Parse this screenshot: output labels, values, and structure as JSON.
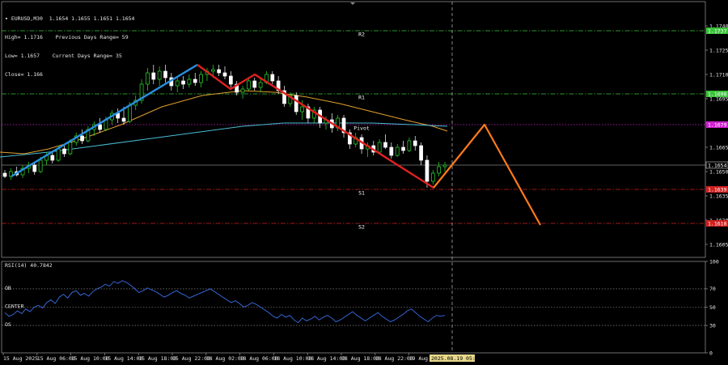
{
  "header": {
    "symbol_line": "EURUSD,M30  1.1654 1.1655 1.1651 1.1654",
    "stats": [
      {
        "left": "High= 1.1716",
        "right": "Previous Days Range= 59"
      },
      {
        "left": "Low= 1.1657",
        "right": "Current Days Range= 35"
      },
      {
        "left": "Close= 1.166",
        "right": ""
      }
    ]
  },
  "chart_data": {
    "type": "candlestick",
    "price_axis": {
      "range": [
        1.1597,
        1.1755
      ],
      "ticks": [
        1.174,
        1.1725,
        1.171,
        1.1695,
        1.168,
        1.1665,
        1.165,
        1.1635,
        1.162,
        1.1605
      ],
      "tick_labels": [
        "1.1740",
        "1.1725",
        "1.1710",
        "1.1695",
        "1.1680",
        "1.1665",
        "1.1650",
        "1.1635",
        "1.1620",
        "1.1605"
      ]
    },
    "levels": [
      {
        "name": "R2",
        "price": 1.1737,
        "tag": "1.1737",
        "color": "#39c439",
        "style": "dashdot",
        "tag_bg": "#39c439"
      },
      {
        "name": "R1",
        "price": 1.1698,
        "tag": "1.1698",
        "color": "#39c439",
        "style": "dashdot",
        "tag_bg": "#39c439"
      },
      {
        "name": "Pivot",
        "price": 1.1679,
        "tag": "1.1679",
        "color": "#d020d0",
        "style": "dotted",
        "tag_bg": "#d020d0"
      },
      {
        "name": "S1",
        "price": 1.1639,
        "tag": "1.1639",
        "color": "#d02020",
        "style": "dashdot",
        "tag_bg": "#d02020"
      },
      {
        "name": "S2",
        "price": 1.1618,
        "tag": "1.1618",
        "color": "#d02020",
        "style": "dashdot",
        "tag_bg": "#d02020"
      }
    ],
    "current_price": {
      "price": 1.1654,
      "tag": "1.1654"
    },
    "x_labels": [
      "15 Aug 2025",
      "15 Aug 06:00",
      "15 Aug 10:00",
      "15 Aug 14:00",
      "15 Aug 18:00",
      "15 Aug 22:00",
      "18 Aug 02:00",
      "18 Aug 06:00",
      "18 Aug 10:00",
      "18 Aug 14:00",
      "18 Aug 18:00",
      "18 Aug 22:00",
      "19 Aug 02:00"
    ],
    "crosshair_label": "2025.08.19 05:30",
    "candles": [
      [
        1.1649,
        1.1651,
        1.1646,
        1.1647
      ],
      [
        1.1647,
        1.1652,
        1.1645,
        1.165
      ],
      [
        1.165,
        1.1653,
        1.1647,
        1.1648
      ],
      [
        1.1648,
        1.1654,
        1.1646,
        1.1652
      ],
      [
        1.1652,
        1.1656,
        1.1649,
        1.1654
      ],
      [
        1.1654,
        1.1656,
        1.1648,
        1.165
      ],
      [
        1.165,
        1.1659,
        1.1649,
        1.1657
      ],
      [
        1.1657,
        1.1662,
        1.1654,
        1.166
      ],
      [
        1.166,
        1.1663,
        1.1655,
        1.1657
      ],
      [
        1.1657,
        1.1666,
        1.1656,
        1.1664
      ],
      [
        1.1664,
        1.1667,
        1.1659,
        1.1661
      ],
      [
        1.1661,
        1.167,
        1.166,
        1.1668
      ],
      [
        1.1668,
        1.1674,
        1.1666,
        1.1672
      ],
      [
        1.1672,
        1.1676,
        1.1667,
        1.1669
      ],
      [
        1.1669,
        1.1678,
        1.1668,
        1.1676
      ],
      [
        1.1676,
        1.1681,
        1.1672,
        1.1679
      ],
      [
        1.1679,
        1.1683,
        1.1674,
        1.1676
      ],
      [
        1.1676,
        1.1684,
        1.1675,
        1.1682
      ],
      [
        1.1682,
        1.1688,
        1.1679,
        1.1686
      ],
      [
        1.1686,
        1.1689,
        1.168,
        1.1683
      ],
      [
        1.1683,
        1.169,
        1.1679,
        1.1681
      ],
      [
        1.1681,
        1.1693,
        1.168,
        1.1691
      ],
      [
        1.1691,
        1.1697,
        1.1688,
        1.1694
      ],
      [
        1.1694,
        1.1707,
        1.1692,
        1.1704
      ],
      [
        1.1704,
        1.1714,
        1.17,
        1.1711
      ],
      [
        1.1711,
        1.1716,
        1.1704,
        1.1707
      ],
      [
        1.1707,
        1.1715,
        1.1703,
        1.1712
      ],
      [
        1.1712,
        1.1716,
        1.1705,
        1.1708
      ],
      [
        1.1708,
        1.1711,
        1.17,
        1.1703
      ],
      [
        1.1703,
        1.1708,
        1.1699,
        1.1706
      ],
      [
        1.1706,
        1.1709,
        1.1701,
        1.1704
      ],
      [
        1.1704,
        1.171,
        1.1702,
        1.1707
      ],
      [
        1.1707,
        1.1711,
        1.1703,
        1.1705
      ],
      [
        1.1705,
        1.1712,
        1.1702,
        1.171
      ],
      [
        1.171,
        1.1714,
        1.1706,
        1.1712
      ],
      [
        1.1712,
        1.1716,
        1.1708,
        1.1713
      ],
      [
        1.1713,
        1.1716,
        1.1709,
        1.1711
      ],
      [
        1.1711,
        1.1715,
        1.1707,
        1.1709
      ],
      [
        1.1709,
        1.1712,
        1.1702,
        1.1704
      ],
      [
        1.1704,
        1.1706,
        1.1697,
        1.1699
      ],
      [
        1.1699,
        1.1703,
        1.1695,
        1.1701
      ],
      [
        1.1701,
        1.1708,
        1.17,
        1.1706
      ],
      [
        1.1706,
        1.1708,
        1.17,
        1.1702
      ],
      [
        1.1702,
        1.1707,
        1.1699,
        1.1705
      ],
      [
        1.1705,
        1.1712,
        1.1704,
        1.171
      ],
      [
        1.171,
        1.1712,
        1.1704,
        1.1706
      ],
      [
        1.1706,
        1.1709,
        1.1698,
        1.17
      ],
      [
        1.17,
        1.1703,
        1.169,
        1.1692
      ],
      [
        1.1692,
        1.1699,
        1.169,
        1.1697
      ],
      [
        1.1697,
        1.1699,
        1.1685,
        1.1687
      ],
      [
        1.1687,
        1.1694,
        1.1682,
        1.169
      ],
      [
        1.169,
        1.1692,
        1.168,
        1.1683
      ],
      [
        1.1683,
        1.169,
        1.168,
        1.1688
      ],
      [
        1.1688,
        1.169,
        1.1677,
        1.168
      ],
      [
        1.168,
        1.1684,
        1.1676,
        1.1682
      ],
      [
        1.1682,
        1.1686,
        1.1674,
        1.1677
      ],
      [
        1.1677,
        1.1685,
        1.1675,
        1.1683
      ],
      [
        1.1683,
        1.1685,
        1.1671,
        1.1674
      ],
      [
        1.1674,
        1.1676,
        1.1664,
        1.1667
      ],
      [
        1.1667,
        1.1674,
        1.1665,
        1.1671
      ],
      [
        1.1671,
        1.1673,
        1.1661,
        1.1664
      ],
      [
        1.1664,
        1.1668,
        1.1659,
        1.1666
      ],
      [
        1.1666,
        1.1669,
        1.166,
        1.1662
      ],
      [
        1.1662,
        1.167,
        1.1661,
        1.1668
      ],
      [
        1.1668,
        1.1673,
        1.1664,
        1.1665
      ],
      [
        1.1665,
        1.1668,
        1.1658,
        1.166
      ],
      [
        1.166,
        1.1667,
        1.1659,
        1.1665
      ],
      [
        1.1665,
        1.1669,
        1.1661,
        1.1663
      ],
      [
        1.1663,
        1.1671,
        1.1662,
        1.1669
      ],
      [
        1.1669,
        1.1672,
        1.1663,
        1.1666
      ],
      [
        1.1666,
        1.1668,
        1.1654,
        1.1657
      ],
      [
        1.1657,
        1.166,
        1.164,
        1.1644
      ],
      [
        1.1644,
        1.1651,
        1.1642,
        1.1649
      ],
      [
        1.1649,
        1.1656,
        1.1647,
        1.1653
      ],
      [
        1.1653,
        1.1656,
        1.165,
        1.1654
      ]
    ],
    "moving_averages": [
      {
        "color": "#e0a030",
        "points": [
          [
            0,
            1.1662
          ],
          [
            30,
            1.1661
          ],
          [
            60,
            1.1664
          ],
          [
            100,
            1.167
          ],
          [
            150,
            1.1679
          ],
          [
            200,
            1.169
          ],
          [
            250,
            1.1697
          ],
          [
            300,
            1.17
          ],
          [
            340,
            1.1699
          ],
          [
            380,
            1.1696
          ],
          [
            420,
            1.1692
          ],
          [
            460,
            1.1687
          ],
          [
            500,
            1.1682
          ],
          [
            535,
            1.1678
          ],
          [
            553,
            1.1675
          ]
        ]
      },
      {
        "color": "#49bcd4",
        "points": [
          [
            0,
            1.1659
          ],
          [
            60,
            1.1662
          ],
          [
            120,
            1.1666
          ],
          [
            180,
            1.167
          ],
          [
            240,
            1.1674
          ],
          [
            300,
            1.1678
          ],
          [
            350,
            1.168
          ],
          [
            400,
            1.168
          ],
          [
            460,
            1.168
          ],
          [
            510,
            1.1679
          ],
          [
            553,
            1.1678
          ]
        ]
      }
    ],
    "trend_lines": [
      {
        "color": "#2a8fe0",
        "points": [
          [
            14,
            1.1647
          ],
          [
            244,
            1.1716
          ]
        ]
      },
      {
        "color": "#e02020",
        "points": [
          [
            244,
            1.1716
          ],
          [
            285,
            1.1701
          ],
          [
            315,
            1.171
          ],
          [
            536,
            1.164
          ]
        ]
      },
      {
        "color": "#ff7a1a",
        "points": [
          [
            536,
            1.164
          ],
          [
            599,
            1.1679
          ],
          [
            668,
            1.1617
          ]
        ]
      }
    ],
    "rsi": {
      "label": "RSI(14) 40.7842",
      "range": [
        0,
        100
      ],
      "tick_labels": [
        "100",
        "70",
        "50",
        "30",
        "0"
      ],
      "levels": [
        {
          "name": "OB",
          "value": 70
        },
        {
          "name": "CENTER",
          "value": 50
        },
        {
          "name": "OS",
          "value": 30
        }
      ],
      "values": [
        44,
        40,
        42,
        46,
        43,
        48,
        45,
        50,
        52,
        49,
        55,
        58,
        54,
        61,
        64,
        60,
        66,
        68,
        63,
        65,
        62,
        67,
        70,
        72,
        75,
        73,
        78,
        76,
        79,
        77,
        74,
        70,
        66,
        68,
        71,
        69,
        67,
        64,
        61,
        63,
        66,
        68,
        65,
        63,
        60,
        62,
        64,
        66,
        68,
        70,
        67,
        64,
        61,
        58,
        55,
        57,
        54,
        50,
        52,
        55,
        53,
        50,
        47,
        44,
        40,
        38,
        42,
        39,
        41,
        36,
        33,
        38,
        35,
        37,
        40,
        36,
        39,
        41,
        38,
        34,
        36,
        39,
        42,
        45,
        41,
        38,
        35,
        38,
        41,
        44,
        40,
        37,
        34,
        36,
        39,
        42,
        46,
        48,
        44,
        40,
        37,
        34,
        38,
        41,
        40,
        41
      ]
    }
  }
}
